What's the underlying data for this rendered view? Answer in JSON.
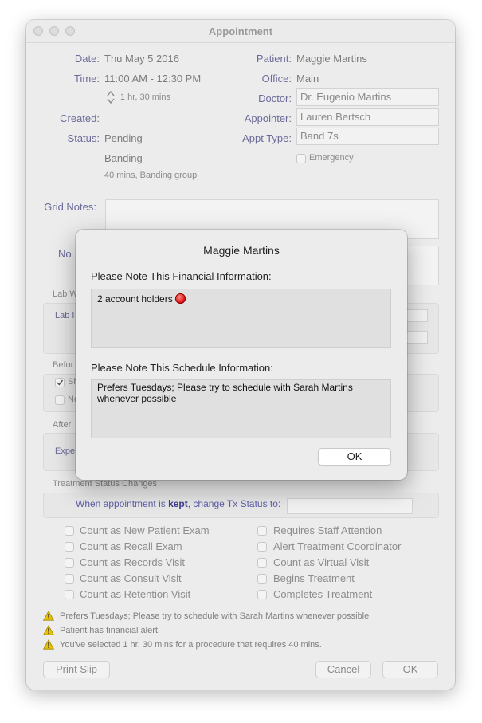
{
  "window": {
    "title": "Appointment"
  },
  "left_fields": {
    "date_label": "Date:",
    "date_value": "Thu May 5 2016",
    "time_label": "Time:",
    "time_value": "11:00 AM - 12:30 PM",
    "duration_value": "1 hr, 30 mins",
    "created_label": "Created:",
    "status_label": "Status:",
    "status_value": "Pending",
    "procedure_value": "Banding",
    "procedure_detail": "40 mins, Banding group"
  },
  "right_fields": {
    "patient_label": "Patient:",
    "patient_value": "Maggie Martins",
    "office_label": "Office:",
    "office_value": "Main",
    "doctor_label": "Doctor:",
    "doctor_value": "Dr. Eugenio Martins",
    "appointer_label": "Appointer:",
    "appointer_value": "Lauren Bertsch",
    "appttype_label": "Appt Type:",
    "appttype_value": "Band 7s",
    "emergency_label": "Emergency"
  },
  "grid_notes_label": "Grid Notes:",
  "partial_labels": {
    "notes_fragment": "No",
    "lab_section_fragment": "Lab W",
    "lab_inner_fragment": "Lab I",
    "before_fragment": "Befor",
    "check1_fragment": "Sh",
    "check2_fragment": "Ne",
    "after_fragment": "After",
    "expect_fragment": "Expe"
  },
  "treatment": {
    "section_label": "Treatment Status Changes",
    "kept_prefix": "When appointment is ",
    "kept_word": "kept",
    "kept_suffix": ", change Tx Status to:"
  },
  "checkboxes_left": [
    "Count as New Patient Exam",
    "Count as Recall Exam",
    "Count as Records Visit",
    "Count as Consult Visit",
    "Count as Retention Visit"
  ],
  "checkboxes_right": [
    "Requires Staff Attention",
    "Alert Treatment Coordinator",
    "Count as Virtual Visit",
    "Begins Treatment",
    "Completes Treatment"
  ],
  "warnings": [
    "Prefers Tuesdays; Please try to schedule with Sarah Martins whenever possible",
    "Patient has financial alert.",
    "You've selected 1 hr, 30 mins for a procedure that requires 40 mins."
  ],
  "buttons": {
    "print_slip": "Print Slip",
    "cancel": "Cancel",
    "ok": "OK"
  },
  "modal": {
    "title": "Maggie Martins",
    "financial_label": "Please Note This Financial Information:",
    "financial_text": "2 account holders",
    "schedule_label": "Please Note This Schedule Information:",
    "schedule_text": "Prefers Tuesdays; Please try to schedule with Sarah Martins whenever possible",
    "ok_label": "OK"
  },
  "colors": {
    "label_blue": "#6b6b9a",
    "alert_red": "#e02020",
    "warning_yellow": "#e8c200"
  }
}
